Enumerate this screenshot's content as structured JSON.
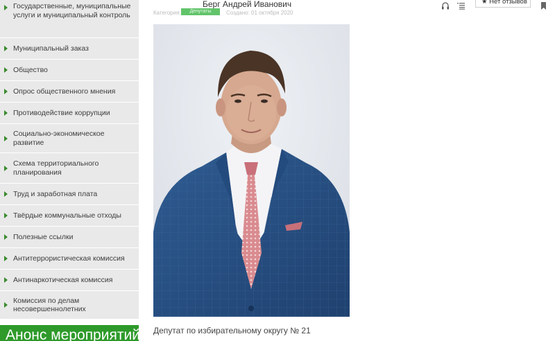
{
  "header": {
    "title": "Берг Андрей Иванович",
    "category_label": "Категория:",
    "category_badge": "Депутаты",
    "date": "Создано: 01 октября 2020",
    "reviews_label": "Нет отзывов",
    "icons": [
      "headphones-icon",
      "list-icon",
      "star-icon",
      "bookmark-icon"
    ]
  },
  "sidebar": {
    "items": [
      {
        "label": "Государственные, муниципальные услуги и муниципальный контроль"
      },
      {
        "label": "Муниципальный заказ"
      },
      {
        "label": "Общество"
      },
      {
        "label": "Опрос общественного мнения"
      },
      {
        "label": "Противодействие коррупции"
      },
      {
        "label": "Социально-экономическое развитие"
      },
      {
        "label": "Схема территориального планирования"
      },
      {
        "label": "Труд и заработная плата"
      },
      {
        "label": "Твёрдые коммунальные отходы"
      },
      {
        "label": "Полезные ссылки"
      },
      {
        "label": "Антитеррористическая комиссия"
      },
      {
        "label": "Антинаркотическая комиссия"
      },
      {
        "label": "Комиссия по делам несовершеннолетних"
      }
    ],
    "announcement_title": "Анонс мероприятий"
  },
  "content": {
    "caption": "Депутат по избирательному округу № 21"
  },
  "colors": {
    "accent_green": "#2e9a2a",
    "arrow_green": "#3a8a2e",
    "sidebar_bg": "#e9e9e9",
    "badge_green": "#62c46a"
  }
}
